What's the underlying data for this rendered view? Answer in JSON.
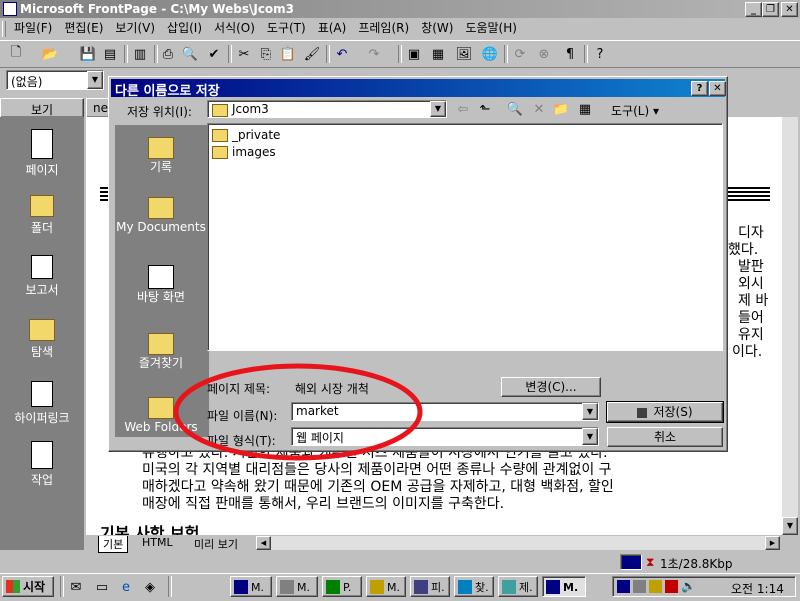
{
  "app": {
    "title": "Microsoft FrontPage - C:\\My Webs\\Jcom3",
    "menu": [
      "파일(F)",
      "편집(E)",
      "보기(V)",
      "삽입(I)",
      "서식(O)",
      "도구(T)",
      "표(A)",
      "프레임(R)",
      "창(W)",
      "도움말(H)"
    ],
    "style_select": "(없음)",
    "views_header": "보기",
    "page_tab_partial": "ne",
    "views": [
      "페이지",
      "폴더",
      "보고서",
      "탐색",
      "하이퍼링크",
      "작업"
    ],
    "bottom_tabs": [
      "기본",
      "HTML",
      "미리 보기"
    ],
    "status": "1초/28.8Kbp",
    "body_lines": [
      "유행하고 있다. 저렴한 제품과 캐주얼 셔츠 제품들이 시장에서 인기를 끌고 있다.",
      "미국의 각 지역별 대리점들은 당사의 제품이라면 어떤 종류나 수량에 관계없이 구",
      "매하겠다고 약속해 왔기 때문에 기존의 OEM 공급을 자제하고, 대형 백화점, 할인",
      "매장에 직접 판매를 통해서, 우리 브랜드의 이미지를 구축한다."
    ],
    "right_fragments": [
      "디자",
      "했다.",
      "발판",
      "외시",
      "제 바",
      "들어",
      "유지",
      "이다."
    ],
    "heading_partial": "기본 사항 보험"
  },
  "dialog": {
    "title": "다른 이름으로 저장",
    "save_in_label": "저장 위치(I):",
    "save_in_value": "Jcom3",
    "tools_label": "도구(L)",
    "places": [
      "기록",
      "My Documents",
      "바탕 화면",
      "즐겨찾기",
      "Web Folders"
    ],
    "files": [
      "_private",
      "images"
    ],
    "page_title_label": "페이지 제목:",
    "page_title_value": "해외 시장 개척",
    "change_button": "변경(C)...",
    "filename_label": "파일 이름(N):",
    "filename_value": "market",
    "filetype_label": "파일 형식(T):",
    "filetype_value": "웹 페이지",
    "save_button": "저장(S)",
    "cancel_button": "취소"
  },
  "taskbar": {
    "start": "시작",
    "tasks": [
      "M.",
      "M.",
      "P.",
      "M.",
      "피.",
      "찾.",
      "제.",
      "M."
    ],
    "clock": "오전 1:14"
  },
  "colors": {
    "title_active": "#000080",
    "desktop_gray": "#c0c0c0",
    "views_bg": "#808080",
    "annotation_red": "#e8141c"
  }
}
